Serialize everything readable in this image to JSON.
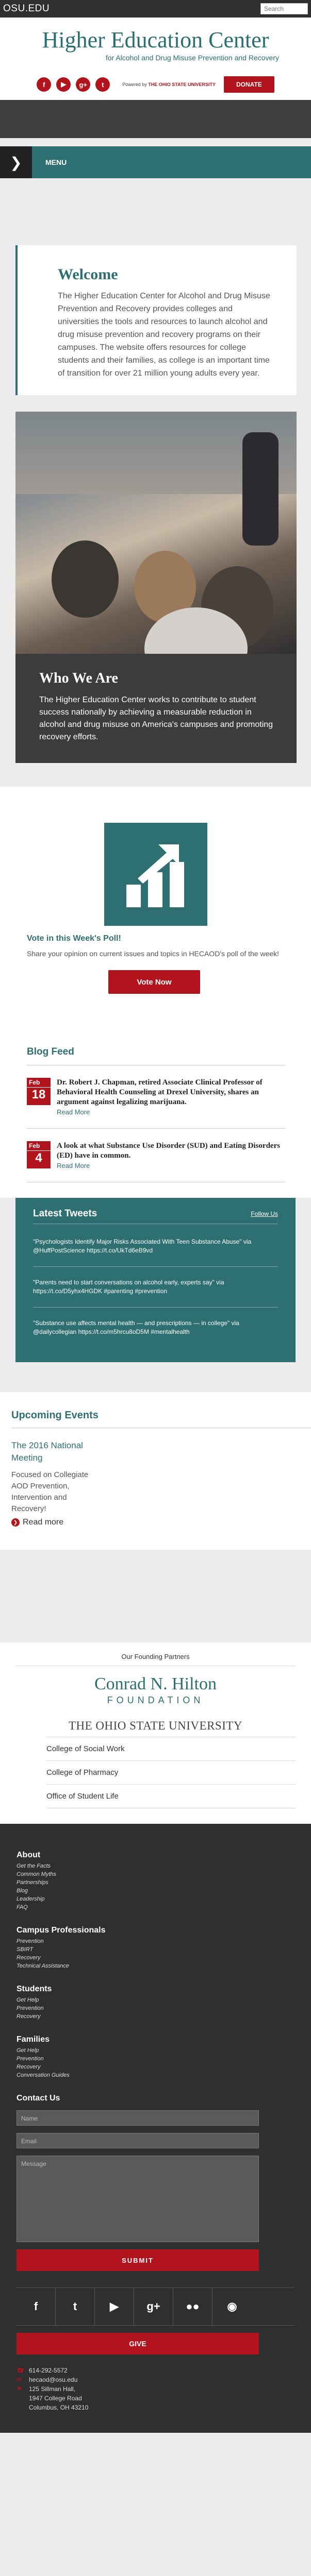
{
  "topbar": {
    "osu": "OSU",
    "osu_suffix": ".EDU",
    "search_placeholder": "Search"
  },
  "brand": {
    "title": "Higher Education Center",
    "subtitle": "for Alcohol and Drug Misuse Prevention and Recovery"
  },
  "social": {
    "powered_by": "Powered by",
    "powered_org": "THE OHIO STATE UNIVERSITY",
    "donate": "DONATE"
  },
  "menu": {
    "label": "MENU"
  },
  "welcome": {
    "title": "Welcome",
    "text": "The Higher Education Center for Alcohol and Drug Misuse Prevention and Recovery provides colleges and universities the tools and resources to launch alcohol and drug misuse prevention and recovery programs on their campuses. The website offers resources for college students and their families, as college is an important time of transition for over 21 million young adults every year."
  },
  "who": {
    "title": "Who We Are",
    "text": "The Higher Education Center works to contribute to student success nationally by achieving a measurable reduction in alcohol and drug misuse on America's campuses and promoting recovery efforts."
  },
  "poll": {
    "title": "Vote in this Week's Poll!",
    "text": "Share your opinion on current issues and topics in HECAOD's poll of the week!",
    "button": "Vote Now"
  },
  "blog": {
    "title": "Blog Feed",
    "posts": [
      {
        "month": "Feb",
        "day": "18",
        "title": "Dr. Robert J. Chapman, retired Associate Clinical Professor of Behavioral Health Counseling at Drexel University, shares an argument against legalizing marijuana.",
        "more": "Read More"
      },
      {
        "month": "Feb",
        "day": "4",
        "title": "A look at what Substance Use Disorder (SUD) and Eating Disorders (ED) have in common.",
        "more": "Read More"
      }
    ]
  },
  "tweets": {
    "title": "Latest Tweets",
    "follow": "Follow Us",
    "items": [
      "\"Psychologists Identify Major Risks Associated With Teen Substance Abuse\" via @HuffPostScience https://t.co/UkTd6eB9vd",
      "\"Parents need to start conversations on alcohol early, experts say\" via https://t.co/D5yhx4HGDK #parenting #prevention",
      "\"Substance use affects mental health — and prescriptions — in college\" via @dailycollegian https://t.co/m5hrcu8oD5M #mentalhealth"
    ]
  },
  "events": {
    "title": "Upcoming Events",
    "event_title": "The 2016 National Meeting",
    "event_text": "Focused on Collegiate AOD Prevention, Intervention and Recovery!",
    "more": "Read more"
  },
  "partners": {
    "label": "Our Founding Partners",
    "hilton": "Conrad N. Hilton",
    "foundation": "FOUNDATION",
    "osu": "THE OHIO STATE UNIVERSITY",
    "links": [
      "College of Social Work",
      "College of Pharmacy",
      "Office of Student Life"
    ]
  },
  "footer": {
    "sections": [
      {
        "title": "About",
        "links": [
          "Get the Facts",
          "Common Myths",
          "Partnerships",
          "Blog",
          "Leadership",
          "FAQ"
        ]
      },
      {
        "title": "Campus Professionals",
        "links": [
          "Prevention",
          "SBIRT",
          "Recovery",
          "Technical Assistance"
        ]
      },
      {
        "title": "Students",
        "links": [
          "Get Help",
          "Prevention",
          "Recovery"
        ]
      },
      {
        "title": "Families",
        "links": [
          "Get Help",
          "Prevention",
          "Recovery",
          "Conversation Guides"
        ]
      }
    ],
    "contact_title": "Contact Us",
    "name_placeholder": "Name",
    "email_placeholder": "Email",
    "message_placeholder": "Message",
    "submit": "SUBMIT",
    "give": "GIVE",
    "phone": "614-292-5572",
    "email": "hecaod@osu.edu",
    "address": [
      "125 Sillman Hall,",
      "1947 College Road",
      "Columbus, OH 43210"
    ]
  }
}
